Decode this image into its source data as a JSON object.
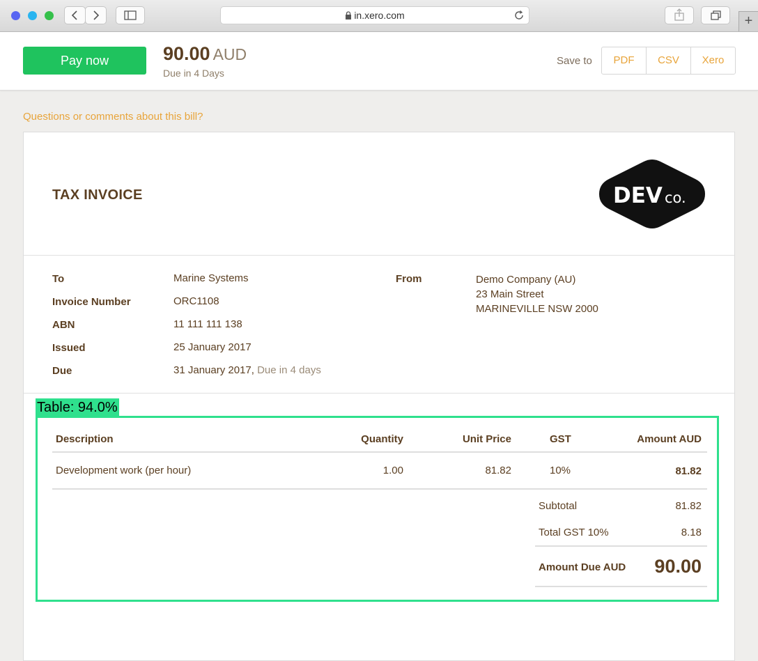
{
  "browser": {
    "url": "in.xero.com",
    "new_tab": "+"
  },
  "topbar": {
    "pay_label": "Pay now",
    "amount": "90.00",
    "currency": "AUD",
    "due_text": "Due in 4 Days",
    "save_to_label": "Save to",
    "save_options": [
      "PDF",
      "CSV",
      "Xero"
    ]
  },
  "questions_link": "Questions or comments about this bill?",
  "invoice": {
    "title": "TAX INVOICE",
    "logo": {
      "main": "DEV",
      "suffix": "co."
    },
    "details": [
      {
        "label": "To",
        "value": "Marine Systems"
      },
      {
        "label": "Invoice Number",
        "value": "ORC1108"
      },
      {
        "label": "ABN",
        "value": "11 111 111 138"
      },
      {
        "label": "Issued",
        "value": "25 January 2017"
      },
      {
        "label": "Due",
        "value": "31 January 2017,",
        "note": "Due in 4 days"
      }
    ],
    "from_label": "From",
    "from_lines": [
      "Demo Company (AU)",
      "23 Main Street",
      "MARINEVILLE NSW 2000"
    ]
  },
  "detection_label": "Table: 94.0%",
  "table": {
    "headers": [
      "Description",
      "Quantity",
      "Unit Price",
      "GST",
      "Amount AUD"
    ],
    "rows": [
      [
        "Development work (per hour)",
        "1.00",
        "81.82",
        "10%",
        "81.82"
      ]
    ],
    "subtotal_label": "Subtotal",
    "subtotal_value": "81.82",
    "gst_label": "Total GST 10%",
    "gst_value": "8.18",
    "due_label": "Amount Due AUD",
    "due_value": "90.00"
  },
  "colors": {
    "pay_green": "#1fc35e",
    "link_orange": "#e8a43a",
    "text_brown": "#5b3f22",
    "detection_green": "#2fe08d"
  }
}
